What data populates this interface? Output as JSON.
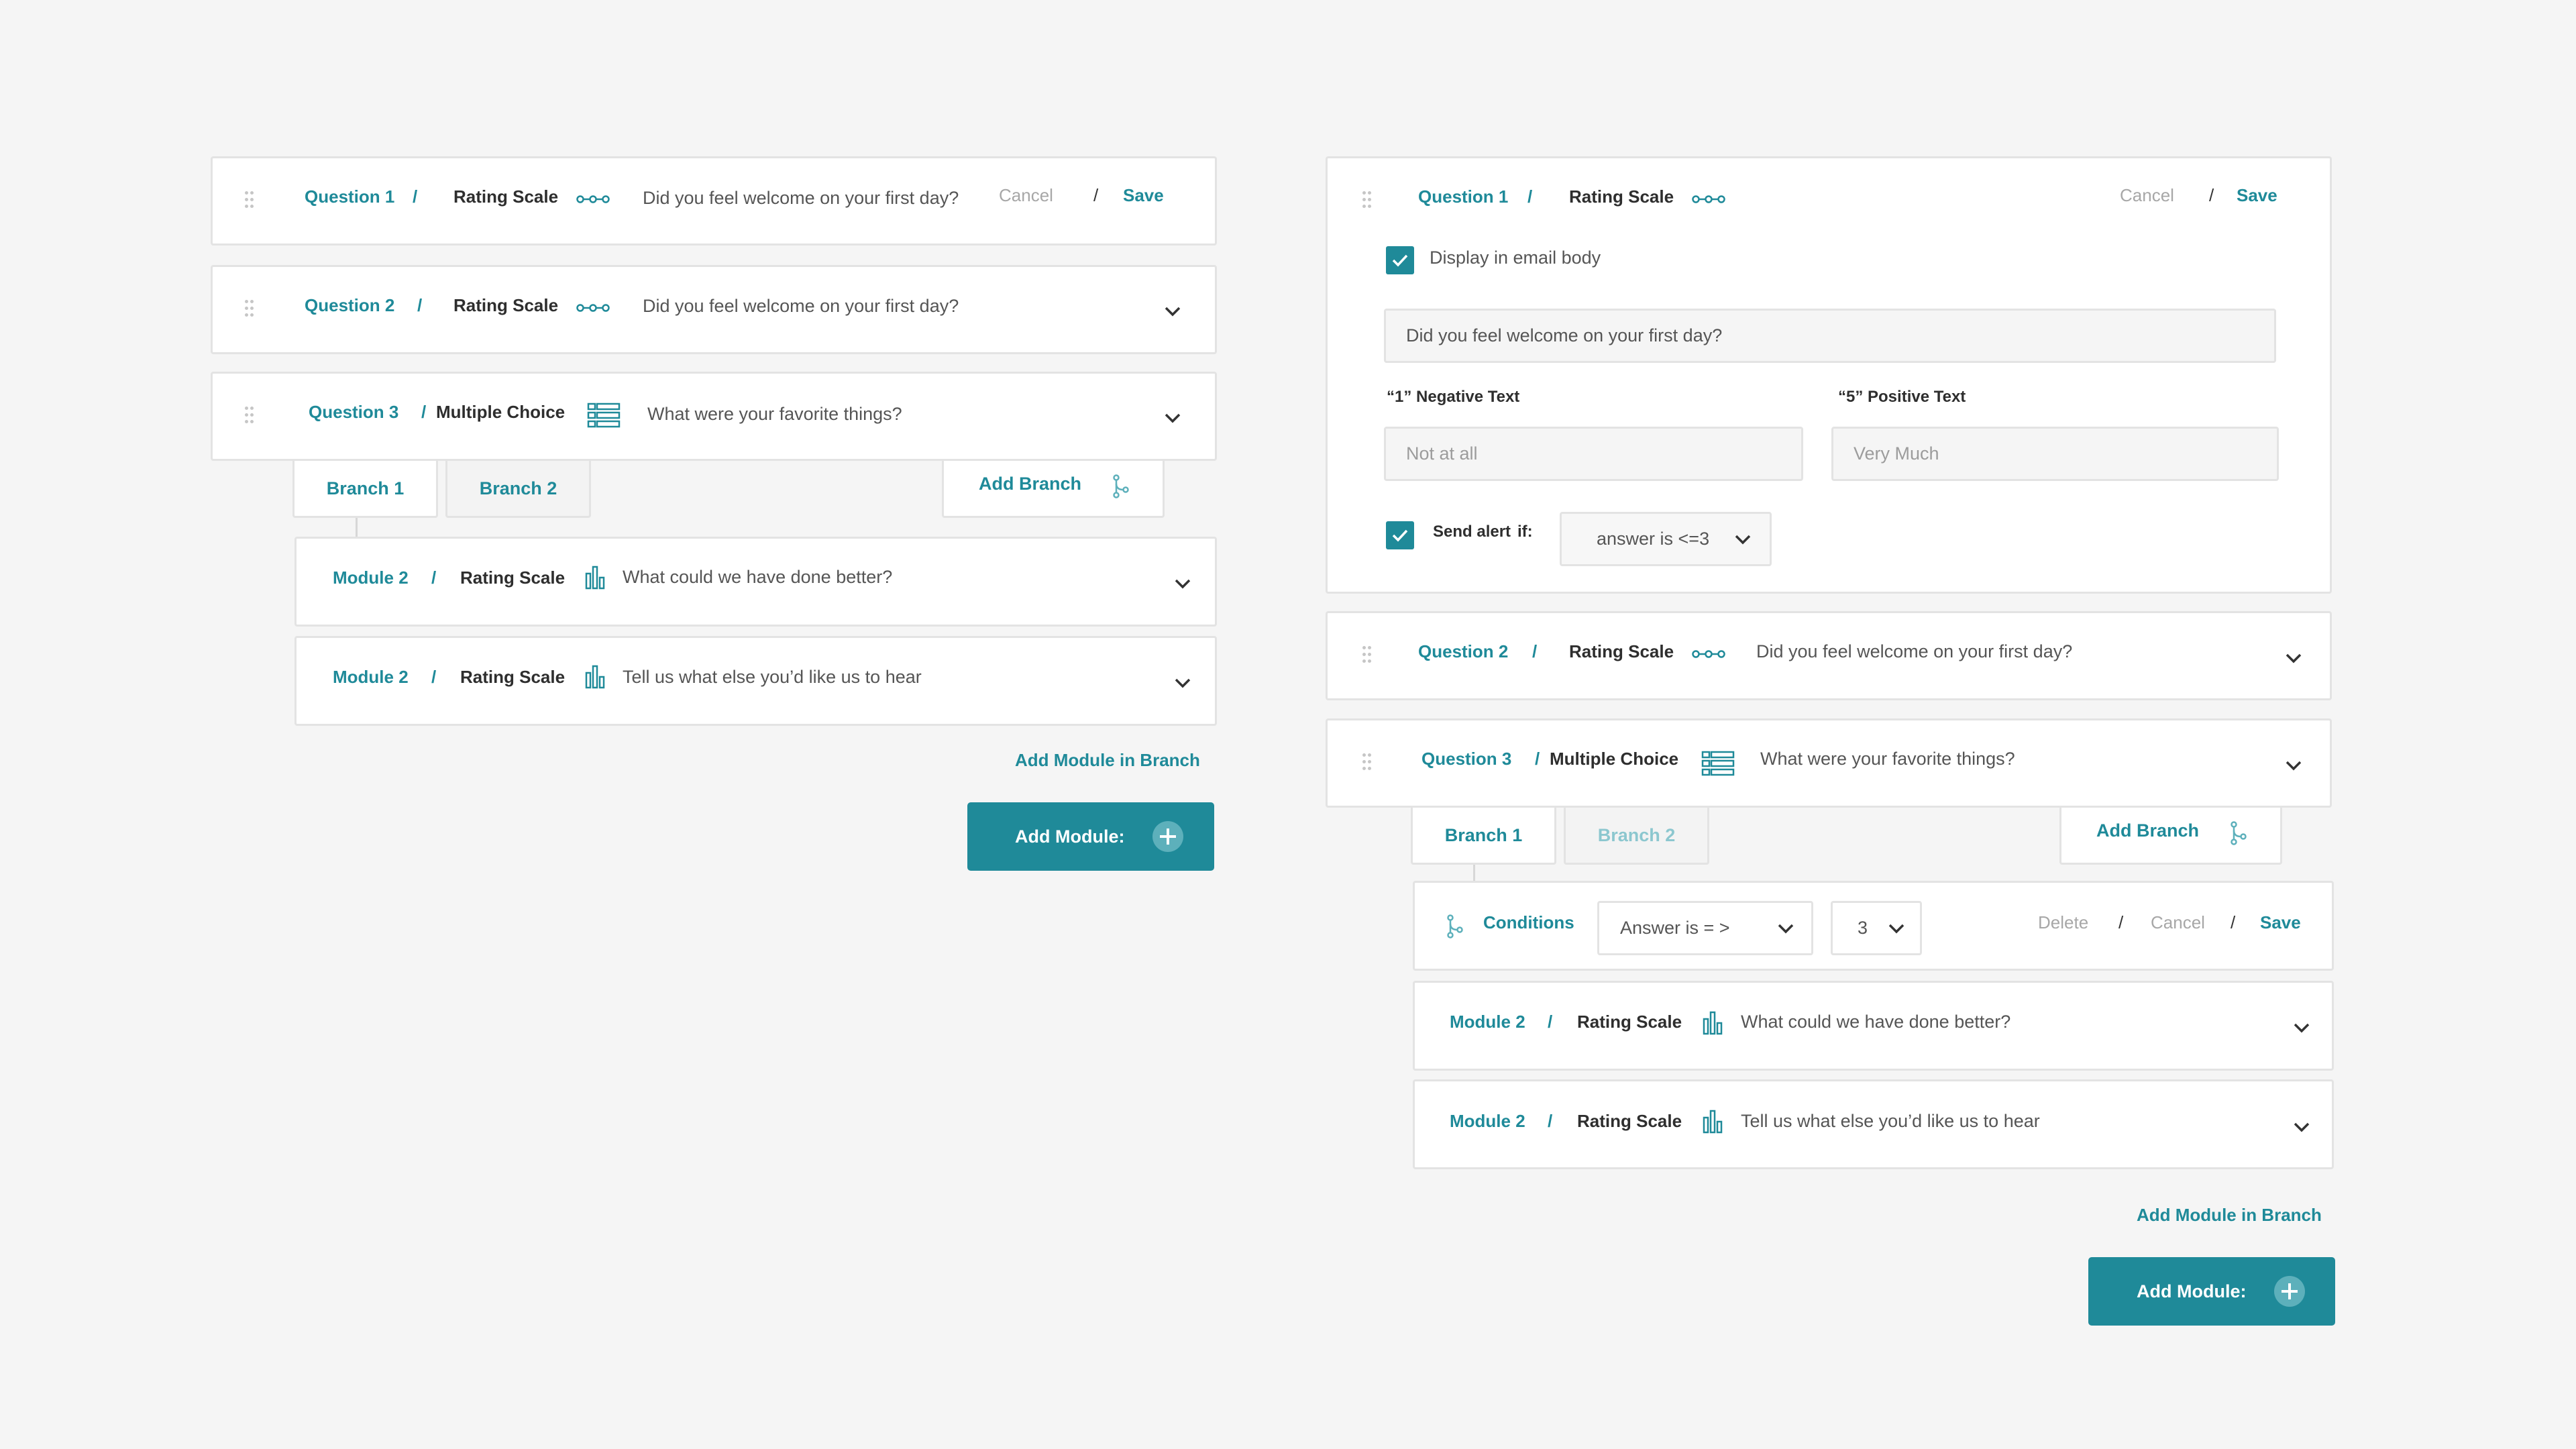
{
  "left": {
    "q1": {
      "label": "Question 1",
      "sep": "/",
      "type": "Rating Scale",
      "icon": "rating-scale-icon",
      "question": "Did you feel welcome on your first day?",
      "cancel": "Cancel",
      "sep2": "/",
      "save": "Save"
    },
    "q2": {
      "label": "Question 2",
      "sep": "/",
      "type": "Rating Scale",
      "icon": "rating-scale-icon",
      "question": "Did you feel welcome on your first day?"
    },
    "q3": {
      "label": "Question 3",
      "sep": "/",
      "type": "Multiple Choice",
      "icon": "multiple-choice-icon",
      "question": "What were your favorite things?"
    },
    "tabs": [
      "Branch 1",
      "Branch 2"
    ],
    "add_branch": "Add Branch",
    "modules": [
      {
        "label": "Module 2",
        "sep": "/",
        "type": "Rating Scale",
        "icon": "bar-chart-icon",
        "question": "What could we have done better?"
      },
      {
        "label": "Module 2",
        "sep": "/",
        "type": "Rating Scale",
        "icon": "bar-chart-icon",
        "question": "Tell us what else you’d like us to hear"
      }
    ],
    "add_module_in_branch": "Add Module in Branch",
    "add_module": "Add Module:"
  },
  "right": {
    "q1": {
      "label": "Question 1",
      "sep": "/",
      "type": "Rating Scale",
      "icon": "rating-scale-icon",
      "cancel": "Cancel",
      "sep2": "/",
      "save": "Save",
      "display_in_email": "Display in email body",
      "question_value": "Did you feel welcome on your first day?",
      "neg_label": "“1” Negative Text",
      "neg_placeholder": "Not at all",
      "pos_label": "“5” Positive Text",
      "pos_placeholder": "Very Much",
      "send_alert": "Send alert",
      "send_alert_if": "if:",
      "alert_condition": "answer is <=3"
    },
    "q2": {
      "label": "Question 2",
      "sep": "/",
      "type": "Rating Scale",
      "icon": "rating-scale-icon",
      "question": "Did you feel welcome on your first day?"
    },
    "q3": {
      "label": "Question 3",
      "sep": "/",
      "type": "Multiple Choice",
      "icon": "multiple-choice-icon",
      "question": "What were your favorite things?"
    },
    "tabs": [
      "Branch 1",
      "Branch 2"
    ],
    "add_branch": "Add Branch",
    "conditions": {
      "label": "Conditions",
      "operator": "Answer is = >",
      "value": "3",
      "delete": "Delete",
      "sep1": "/",
      "cancel": "Cancel",
      "sep2": "/",
      "save": "Save"
    },
    "modules": [
      {
        "label": "Module 2",
        "sep": "/",
        "type": "Rating Scale",
        "icon": "bar-chart-icon",
        "question": "What could we have done better?"
      },
      {
        "label": "Module 2",
        "sep": "/",
        "type": "Rating Scale",
        "icon": "bar-chart-icon",
        "question": "Tell us what else you’d like us to hear"
      }
    ],
    "add_module_in_branch": "Add Module in Branch",
    "add_module": "Add Module:"
  },
  "colors": {
    "accent": "#1f8a99",
    "accent_light": "#5db0bb",
    "border": "#e3e3e3",
    "background": "#f5f5f5"
  }
}
